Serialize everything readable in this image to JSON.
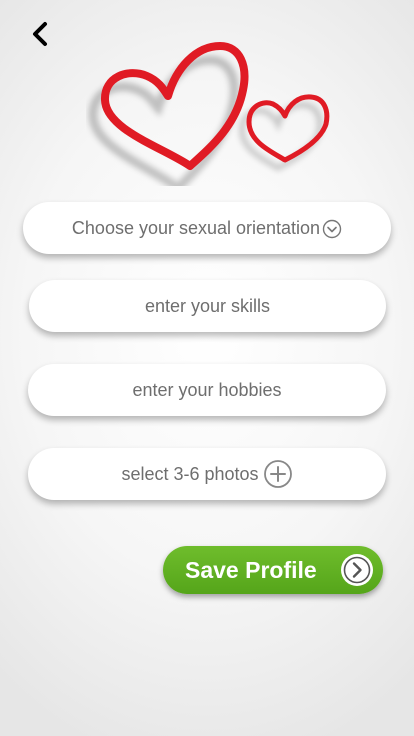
{
  "icons": {
    "back": "chevron-left-icon",
    "hearts": "hearts-logo-icon",
    "dropdown": "chevron-down-circle-icon",
    "add_photo": "plus-circle-icon",
    "save_arrow": "chevron-right-circle-icon"
  },
  "colors": {
    "heart_red": "#e01b24",
    "save_green": "#5fb021",
    "field_text": "#6e6e6e"
  },
  "form": {
    "orientation_placeholder": "Choose your sexual orientation",
    "skills_placeholder": "enter your skills",
    "hobbies_placeholder": "enter your hobbies",
    "photos_label": "select 3-6 photos"
  },
  "actions": {
    "save_label": "Save Profile"
  }
}
